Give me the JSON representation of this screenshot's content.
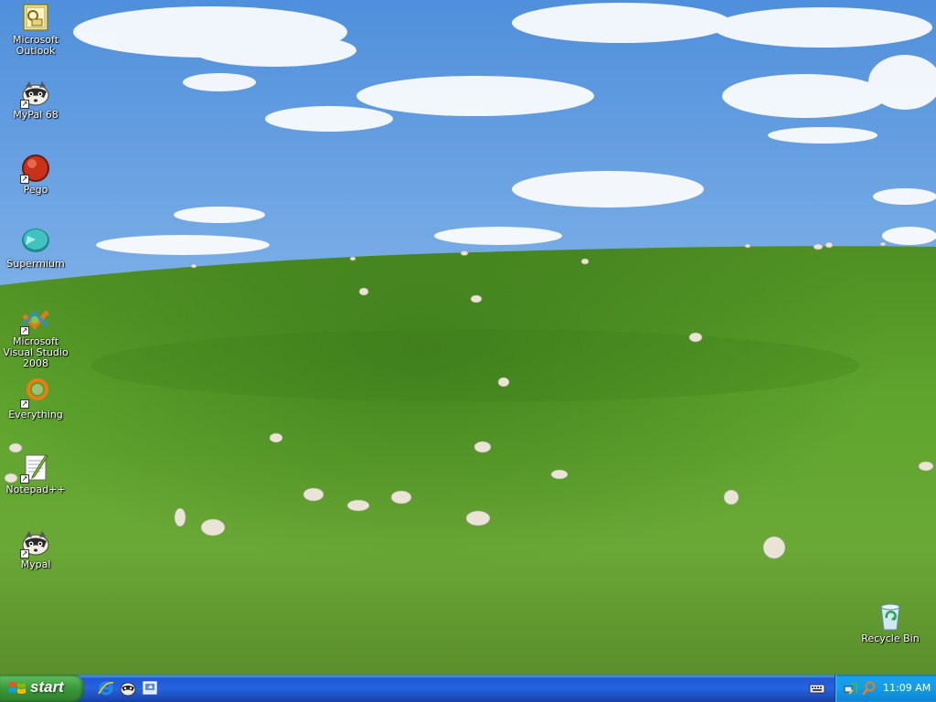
{
  "desktop": {
    "icons": [
      {
        "label": "Microsoft Outlook",
        "icon": "outlook-icon",
        "shortcut": false
      },
      {
        "label": "MyPal 68",
        "icon": "mypal-raccoon-icon",
        "shortcut": true
      },
      {
        "label": "Pego",
        "icon": "pego-red-ball-icon",
        "shortcut": true
      },
      {
        "label": "Supermium",
        "icon": "supermium-teal-icon",
        "shortcut": false
      },
      {
        "label": "Microsoft Visual Studio 2008",
        "icon": "visual-studio-icon",
        "shortcut": true
      },
      {
        "label": "Everything",
        "icon": "everything-search-icon",
        "shortcut": true
      },
      {
        "label": "Notepad++",
        "icon": "notepad-plus-plus-icon",
        "shortcut": true
      },
      {
        "label": "Mypal",
        "icon": "mypal-raccoon-icon",
        "shortcut": true
      },
      {
        "label": "Recycle Bin",
        "icon": "recycle-bin-icon",
        "shortcut": false
      }
    ],
    "wallpaper": "green-hill-with-sheep-blue-sky"
  },
  "taskbar": {
    "start_label": "start",
    "quick_launch": [
      {
        "icon": "internet-explorer-icon"
      },
      {
        "icon": "mypal-raccoon-icon"
      },
      {
        "icon": "show-desktop-icon"
      }
    ],
    "tray": {
      "language_icon": "keyboard-language-icon",
      "icons": [
        "network-icon",
        "search-tray-icon"
      ],
      "clock": "11:09 AM"
    }
  },
  "colors": {
    "taskbar_blue": "#2663e0",
    "start_green": "#3a9a3a",
    "tray_blue": "#139de8",
    "sky_blue": "#6fa8e6",
    "grass_green": "#5a9a2a"
  }
}
